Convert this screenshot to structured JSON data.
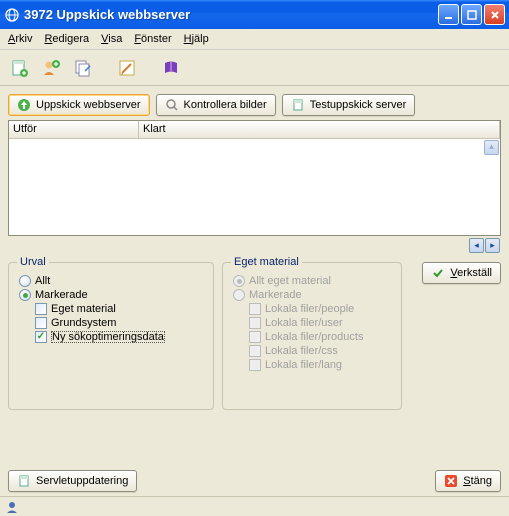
{
  "title": "3972 Uppskick webbserver",
  "menu": {
    "arkiv": "Arkiv",
    "redigera": "Redigera",
    "visa": "Visa",
    "fonster": "Fönster",
    "hjalp": "Hjälp"
  },
  "actions": {
    "uppskick": "Uppskick webbserver",
    "kontrollera": "Kontrollera bilder",
    "testuppskick": "Testuppskick server"
  },
  "list": {
    "col_utfor": "Utför",
    "col_klart": "Klart",
    "rows": []
  },
  "urval": {
    "legend": "Urval",
    "allt": "Allt",
    "markerade": "Markerade",
    "eget_material": "Eget material",
    "grundsystem": "Grundsystem",
    "ny_seo": "Ny sökoptimeringsdata"
  },
  "eget": {
    "legend": "Eget material",
    "allt": "Allt eget material",
    "markerade": "Markerade",
    "items": [
      "Lokala filer/people",
      "Lokala filer/user",
      "Lokala filer/products",
      "Lokala filer/css",
      "Lokala filer/lang"
    ]
  },
  "buttons": {
    "verkstall": "Verkställ",
    "servletuppdatering": "Servletuppdatering",
    "stang": "Stäng"
  }
}
